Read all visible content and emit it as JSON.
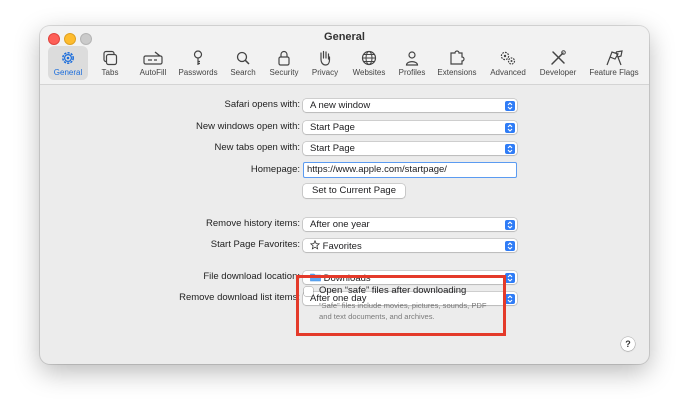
{
  "window": {
    "title": "General"
  },
  "toolbar": {
    "items": [
      {
        "label": "General",
        "icon": "gear-icon",
        "selected": true
      },
      {
        "label": "Tabs",
        "icon": "tabs-icon"
      },
      {
        "label": "AutoFill",
        "icon": "autofill-icon"
      },
      {
        "label": "Passwords",
        "icon": "key-icon"
      },
      {
        "label": "Search",
        "icon": "search-icon"
      },
      {
        "label": "Security",
        "icon": "lock-icon"
      },
      {
        "label": "Privacy",
        "icon": "hand-icon"
      },
      {
        "label": "Websites",
        "icon": "globe-icon"
      },
      {
        "label": "Profiles",
        "icon": "person-icon"
      },
      {
        "label": "Extensions",
        "icon": "puzzle-icon"
      },
      {
        "label": "Advanced",
        "icon": "gears-icon"
      },
      {
        "label": "Developer",
        "icon": "tools-icon"
      },
      {
        "label": "Feature Flags",
        "icon": "flags-icon"
      }
    ],
    "accent_color": "#1a6cdb"
  },
  "settings": {
    "safari_opens_with": {
      "label": "Safari opens with:",
      "value": "A new window"
    },
    "new_windows": {
      "label": "New windows open with:",
      "value": "Start Page"
    },
    "new_tabs": {
      "label": "New tabs open with:",
      "value": "Start Page"
    },
    "homepage": {
      "label": "Homepage:",
      "value": "https://www.apple.com/startpage/"
    },
    "set_current_page": "Set to Current Page",
    "remove_history": {
      "label": "Remove history items:",
      "value": "After one year"
    },
    "start_page_favorites": {
      "label": "Start Page Favorites:",
      "value": "Favorites",
      "icon": "star-icon"
    },
    "download_location": {
      "label": "File download location:",
      "value": "Downloads",
      "icon": "folder-icon"
    },
    "remove_download_list": {
      "label": "Remove download list items:",
      "value": "After one day"
    },
    "open_safe_files": {
      "label": "Open “safe” files after downloading",
      "checked": false,
      "note": "“Safe” files include movies, pictures, sounds, PDF and text documents, and archives."
    }
  },
  "help": "?",
  "highlight_color": "#e43a2a"
}
